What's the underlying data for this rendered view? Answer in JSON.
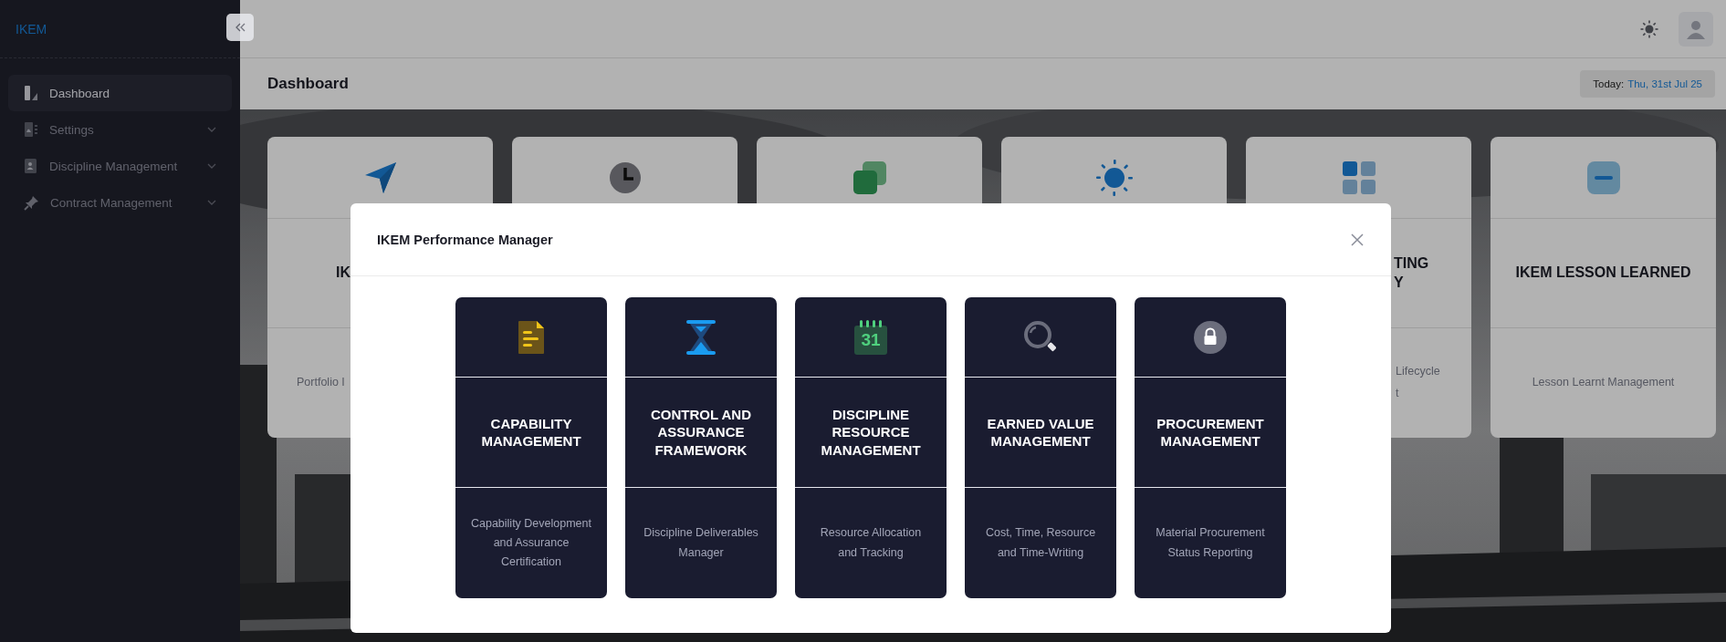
{
  "sidebar": {
    "brand": "IKEM",
    "items": [
      {
        "label": "Dashboard",
        "selected": true,
        "expandable": false
      },
      {
        "label": "Settings",
        "selected": false,
        "expandable": true
      },
      {
        "label": "Discipline Management",
        "selected": false,
        "expandable": true
      },
      {
        "label": "Contract Management",
        "selected": false,
        "expandable": true
      }
    ]
  },
  "page": {
    "title": "Dashboard",
    "today_label": "Today:",
    "today_value": "Thu, 31st Jul 25"
  },
  "cards": [
    {
      "kind": "cut-right",
      "title_lines": [
        "IK"
      ],
      "description_lines": [
        "Portfolio I"
      ]
    },
    {
      "kind": "hidden"
    },
    {
      "kind": "hidden"
    },
    {
      "kind": "hidden"
    },
    {
      "kind": "cut-left",
      "title_lines": [
        "TING",
        "Y"
      ],
      "description_lines": [
        "Lifecycle",
        "t"
      ]
    },
    {
      "kind": "full",
      "title_lines": [
        "IKEM LESSON LEARNED"
      ],
      "description_lines": [
        "Lesson Learnt Management"
      ]
    }
  ],
  "modal": {
    "title": "IKEM Performance Manager",
    "cards": [
      {
        "title": "CAPABILITY MANAGEMENT",
        "description": "Capability Development and Assurance Certification"
      },
      {
        "title": "CONTROL AND ASSURANCE FRAMEWORK",
        "description": "Discipline Deliverables Manager"
      },
      {
        "title": "DISCIPLINE RESOURCE MANAGEMENT",
        "description": "Resource Allocation and Tracking",
        "icon_text": "31"
      },
      {
        "title": "EARNED VALUE MANAGEMENT",
        "description": "Cost, Time, Resource and Time-Writing"
      },
      {
        "title": "PROCUREMENT MANAGEMENT",
        "description": "Material Procurement Status Reporting"
      }
    ]
  }
}
